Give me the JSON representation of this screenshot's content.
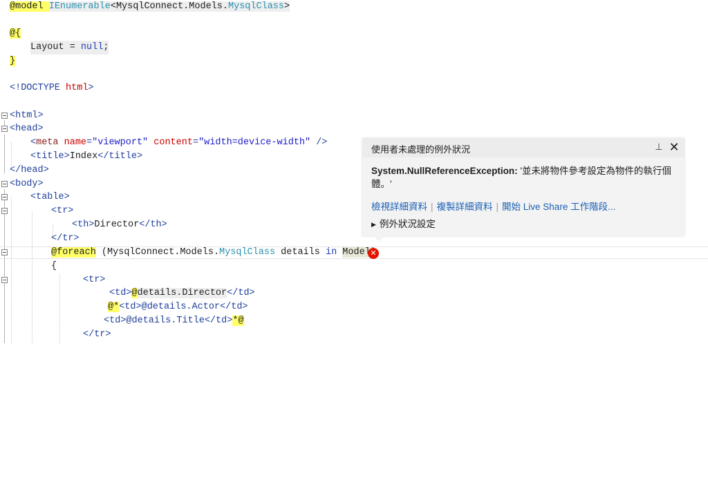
{
  "code": {
    "l1": {
      "kw": "@model",
      "type": "IEnumerable",
      "mid": "<MysqlConnect.Models.",
      "type2": "MysqlClass",
      "end": ">"
    },
    "l2": {
      "text": "@{"
    },
    "l3": {
      "a": "Layout = ",
      "b": "null",
      "c": ";"
    },
    "l4": {
      "text": "}"
    },
    "l5": {
      "a": "<!DOCTYPE ",
      "b": "html",
      "c": ">"
    },
    "l6": {
      "text": "<html>"
    },
    "l7": {
      "text": "<head>"
    },
    "l8": {
      "a": "<",
      "b": "meta",
      "c": " name",
      "d": "=",
      "e": "\"viewport\"",
      "f": " content",
      "g": "=",
      "h": "\"width=device-width\"",
      "i": " />"
    },
    "l9": {
      "a": "<title>",
      "b": "Index",
      "c": "</title>"
    },
    "l10": {
      "text": "</head>"
    },
    "l11": {
      "text": "<body>"
    },
    "l12": {
      "text": "<table>"
    },
    "l13": {
      "text": "<tr>"
    },
    "l14": {
      "a": "<th>",
      "b": "Director",
      "c": "</th>"
    },
    "l15": {
      "text": "</tr>"
    },
    "l16": {
      "a": "@foreach",
      "b": " (MysqlConnect.Models.",
      "c": "MysqlClass",
      "d": " details ",
      "e": "in",
      "f": " ",
      "g": "Model",
      "h": ")"
    },
    "l17": {
      "text": "{"
    },
    "l18": {
      "text": "<tr>"
    },
    "l19": {
      "a": "<td>",
      "b": "@",
      "c": "details.Director",
      "d": "</td>"
    },
    "l20": {
      "a": "@*",
      "b": "<td>@details.Actor</td>"
    },
    "l21": {
      "a": "<td>@details.Title</td>",
      "b": "*@"
    },
    "l22": {
      "text": "</tr>"
    }
  },
  "popup": {
    "title": "使用者未處理的例外狀況",
    "exception_type": "System.NullReferenceException:",
    "exception_message": " '並未將物件參考設定為物件的執行個體。'",
    "links": [
      "檢視詳細資料",
      "複製詳細資料",
      "開始 Live Share 工作階段..."
    ],
    "settings": "例外狀況設定",
    "pin_glyph": "⊥",
    "close_glyph": "✕",
    "settings_glyph": "▶"
  },
  "error_glyph": "✕",
  "colors": {
    "razor_highlight": "#ffff66",
    "tag": "#1f3f9c",
    "attribute": "#cc0000",
    "type": "#2b91af",
    "error": "#e51400",
    "link": "#1a5fb4"
  }
}
